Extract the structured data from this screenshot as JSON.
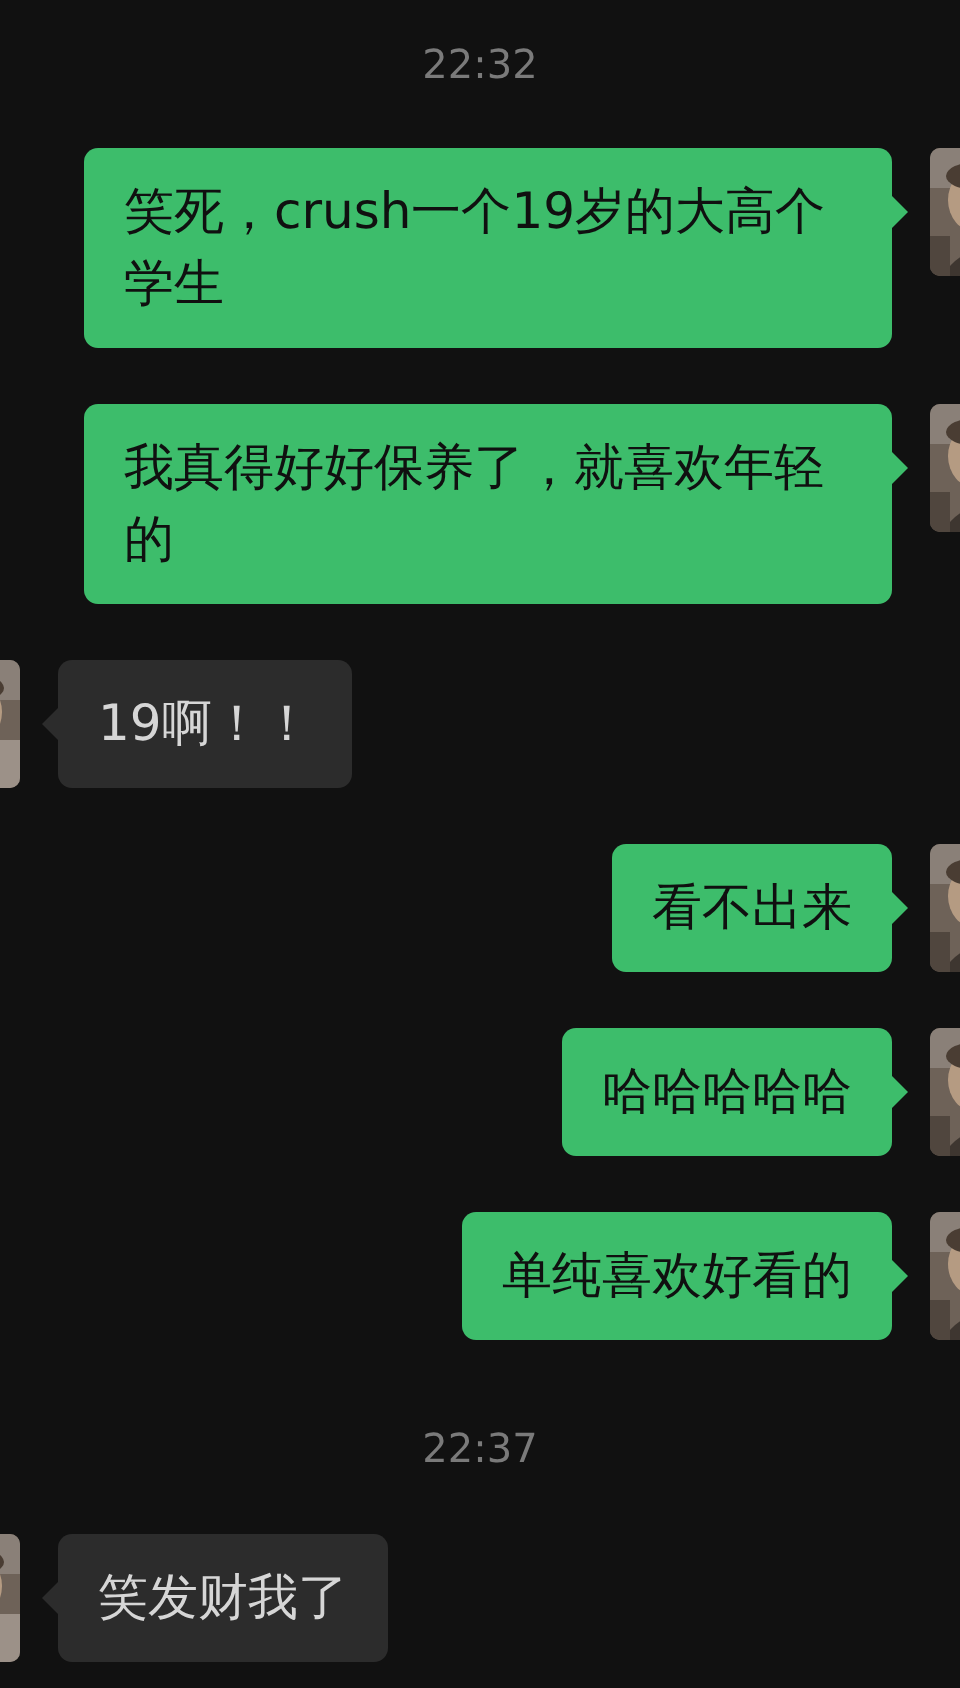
{
  "messages": [
    {
      "kind": "time",
      "text": "22:32"
    },
    {
      "kind": "sent",
      "text": "笑死，crush一个19岁的大高个学生"
    },
    {
      "kind": "sent",
      "text": "我真得好好保养了，就喜欢年轻的"
    },
    {
      "kind": "received",
      "text": "19啊！！"
    },
    {
      "kind": "sent",
      "text": "看不出来"
    },
    {
      "kind": "sent",
      "text": "哈哈哈哈哈"
    },
    {
      "kind": "sent",
      "text": "单纯喜欢好看的"
    },
    {
      "kind": "time",
      "text": "22:37"
    },
    {
      "kind": "received",
      "text": "笑发财我了"
    }
  ]
}
